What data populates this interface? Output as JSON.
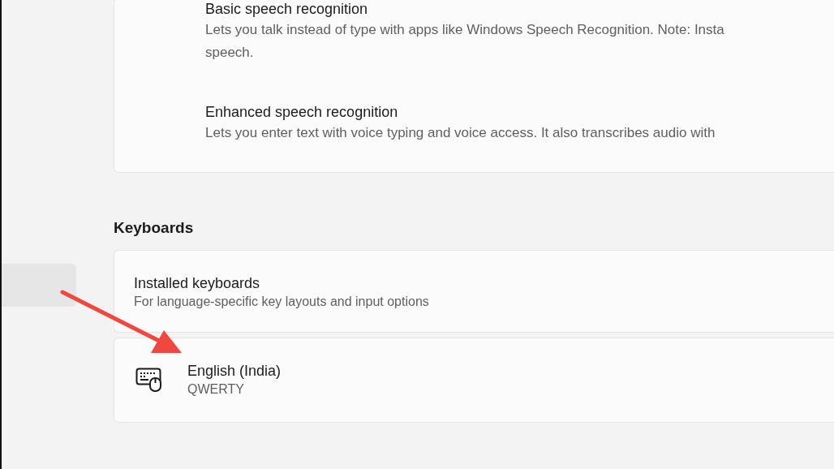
{
  "sidebar": {
    "items": [
      {
        "selected": true
      }
    ]
  },
  "speech_options": [
    {
      "title": "Basic speech recognition",
      "description": "Lets you talk instead of type with apps like Windows Speech Recognition. Note: Insta",
      "description_2": "speech."
    },
    {
      "title": "Enhanced speech recognition",
      "description": "Lets you enter text with voice typing and voice access. It also transcribes audio with"
    }
  ],
  "keyboards": {
    "heading": "Keyboards",
    "header": {
      "title": "Installed keyboards",
      "subtitle": "For language-specific key layouts and input options"
    },
    "items": [
      {
        "name": "English (India)",
        "layout": "QWERTY"
      }
    ]
  }
}
